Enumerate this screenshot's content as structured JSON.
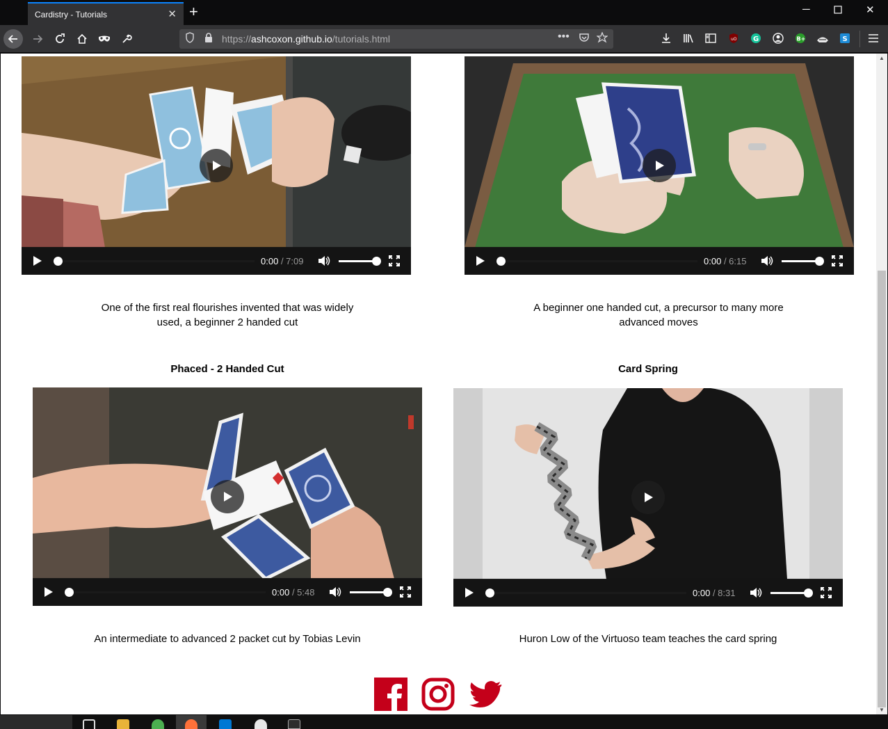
{
  "browser": {
    "tab_title": "Cardistry - Tutorials",
    "url_scheme": "https://",
    "url_host": "ashcoxon.github.io",
    "url_path": "/tutorials.html",
    "accent_color": "#0a84ff"
  },
  "tutorials": [
    {
      "title": "",
      "time_current": "0:00",
      "time_duration": "/ 7:09",
      "description": "One of the first real flourishes invented that was widely used, a beginner 2 handed cut"
    },
    {
      "title": "",
      "time_current": "0:00",
      "time_duration": "/ 6:15",
      "description": "A beginner one handed cut, a precursor to many more advanced moves"
    },
    {
      "title": "Phaced - 2 Handed Cut",
      "time_current": "0:00",
      "time_duration": "/ 5:48",
      "description": "An intermediate to advanced 2 packet cut by Tobias Levin"
    },
    {
      "title": "Card Spring",
      "time_current": "0:00",
      "time_duration": "/ 8:31",
      "description": "Huron Low of the Virtuoso team teaches the card spring"
    }
  ],
  "footer": {
    "social_icons": [
      "facebook-icon",
      "instagram-icon",
      "twitter-icon"
    ],
    "social_color": "#c4001a"
  }
}
